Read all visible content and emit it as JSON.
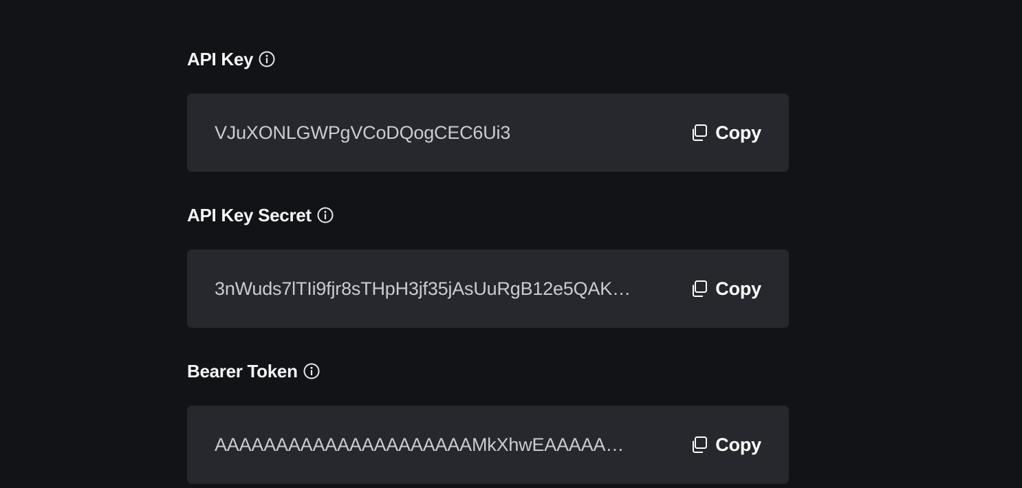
{
  "credentials": [
    {
      "label": "API Key",
      "info_icon": "info-circle-icon",
      "value": "VJuXONLGWPgVCoDQogCEC6Ui3",
      "copy_label": "Copy",
      "copy_icon": "copy-icon"
    },
    {
      "label": "API Key Secret",
      "info_icon": "info-circle-icon",
      "value": "3nWuds7lTIi9fjr8sTHpH3jf35jAsUuRgB12e5QAK…",
      "copy_label": "Copy",
      "copy_icon": "copy-icon"
    },
    {
      "label": "Bearer Token",
      "info_icon": "info-circle-icon",
      "value": "AAAAAAAAAAAAAAAAAAAAAMkXhwEAAAAA…",
      "copy_label": "Copy",
      "copy_icon": "copy-icon"
    }
  ],
  "colors": {
    "background": "#111317",
    "field_background": "#26282d",
    "label_text": "#f5f6f7",
    "value_text": "#c9cdd2"
  }
}
